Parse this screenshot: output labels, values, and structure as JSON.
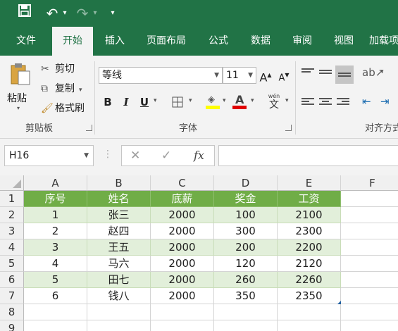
{
  "qa": {
    "save": "💾",
    "undo": "↶",
    "redo": "↷",
    "more": "▾"
  },
  "tabs": [
    "文件",
    "开始",
    "插入",
    "页面布局",
    "公式",
    "数据",
    "审阅",
    "视图",
    "加载项"
  ],
  "ribbon": {
    "clipboard": {
      "paste": "粘贴",
      "cut": "剪切",
      "copy": "复制",
      "format_painter": "格式刷",
      "label": "剪贴板"
    },
    "font": {
      "font_name": "等线",
      "font_size": "11",
      "grow": "A",
      "shrink": "A",
      "bold": "B",
      "italic": "I",
      "underline": "U",
      "phonetic": "wén",
      "phonetic_char": "文",
      "label": "字体"
    },
    "align": {
      "label": "对齐方式"
    }
  },
  "formula_bar": {
    "name_box": "H16",
    "cancel": "✕",
    "enter": "✓",
    "fx": "fx",
    "value": ""
  },
  "sheet": {
    "columns": [
      "A",
      "B",
      "C",
      "D",
      "E",
      "F"
    ],
    "rows": [
      "1",
      "2",
      "3",
      "4",
      "5",
      "6",
      "7",
      "8",
      "9"
    ],
    "header": [
      "序号",
      "姓名",
      "底薪",
      "奖金",
      "工资"
    ],
    "data": [
      [
        "1",
        "张三",
        "2000",
        "100",
        "2100"
      ],
      [
        "2",
        "赵四",
        "2000",
        "300",
        "2300"
      ],
      [
        "3",
        "王五",
        "2000",
        "200",
        "2200"
      ],
      [
        "4",
        "马六",
        "2000",
        "120",
        "2120"
      ],
      [
        "5",
        "田七",
        "2000",
        "260",
        "2260"
      ],
      [
        "6",
        "钱八",
        "2000",
        "350",
        "2350"
      ]
    ]
  },
  "colors": {
    "accent": "#217346",
    "table_header": "#70ad47",
    "table_band": "#e2efda"
  }
}
